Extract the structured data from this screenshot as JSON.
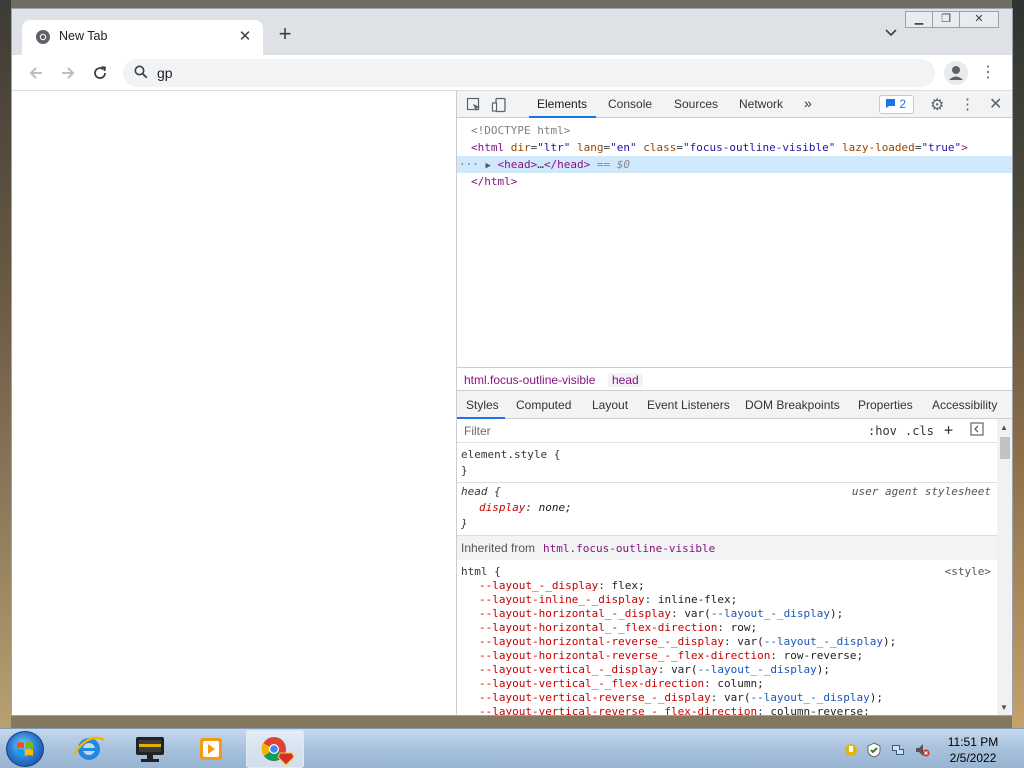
{
  "browser": {
    "tab": {
      "title": "New Tab"
    },
    "omnibox": {
      "value": "gp"
    }
  },
  "devtools": {
    "tabs": [
      "Elements",
      "Console",
      "Sources",
      "Network"
    ],
    "more_tabs": "»",
    "issues_count": "2",
    "dom": {
      "doctype": "<!DOCTYPE html>",
      "html_open": {
        "tag_open": "<html",
        "attrs": [
          {
            "name": "dir",
            "value": "\"ltr\""
          },
          {
            "name": "lang",
            "value": "\"en\""
          },
          {
            "name": "class",
            "value": "\"focus-outline-visible\""
          },
          {
            "name": "lazy-loaded",
            "value": "\"true\""
          }
        ],
        "tag_close": ">"
      },
      "head_line": {
        "dots": "···",
        "open": "<head>",
        "ellipsis": "…",
        "close": "</head>",
        "eq": "== $0"
      },
      "html_close": "</html>"
    },
    "breadcrumbs": [
      "html.focus-outline-visible",
      "head"
    ],
    "styles_tabs": [
      "Styles",
      "Computed",
      "Layout",
      "Event Listeners",
      "DOM Breakpoints",
      "Properties",
      "Accessibility"
    ],
    "filter_placeholder": "Filter",
    "filter_buttons": {
      "hov": ":hov",
      "cls": ".cls",
      "add": "+"
    },
    "element_style": {
      "selector": "element.style {",
      "close": "}"
    },
    "head_rule": {
      "selector": "head {",
      "source": "user agent stylesheet",
      "prop": "display",
      "value": "none;",
      "close": "}"
    },
    "inherited": {
      "label": "Inherited from",
      "selector": "html.focus-outline-visible"
    },
    "html_rule": {
      "selector": "html {",
      "source": "<style>",
      "props": [
        {
          "name": "--layout_-_display",
          "value": "flex;"
        },
        {
          "name": "--layout-inline_-_display",
          "value": "inline-flex;"
        },
        {
          "name": "--layout-horizontal_-_display",
          "value_pre": "var(",
          "var": "--layout_-_display",
          "value_post": ");"
        },
        {
          "name": "--layout-horizontal_-_flex-direction",
          "value": "row;"
        },
        {
          "name": "--layout-horizontal-reverse_-_display",
          "value_pre": "var(",
          "var": "--layout_-_display",
          "value_post": ");"
        },
        {
          "name": "--layout-horizontal-reverse_-_flex-direction",
          "value": "row-reverse;"
        },
        {
          "name": "--layout-vertical_-_display",
          "value_pre": "var(",
          "var": "--layout_-_display",
          "value_post": ");"
        },
        {
          "name": "--layout-vertical_-_flex-direction",
          "value": "column;"
        },
        {
          "name": "--layout-vertical-reverse_-_display",
          "value_pre": "var(",
          "var": "--layout_-_display",
          "value_post": ");"
        },
        {
          "name": "--layout-vertical-reverse_-_flex-direction",
          "value": "column-reverse;"
        }
      ]
    }
  },
  "taskbar": {
    "clock": {
      "time": "11:51 PM",
      "date": "2/5/2022"
    }
  },
  "colors": {
    "accent": "#1a73e8",
    "selected_row": "#cfe8fc",
    "taskbar": "#a8c2dd"
  }
}
